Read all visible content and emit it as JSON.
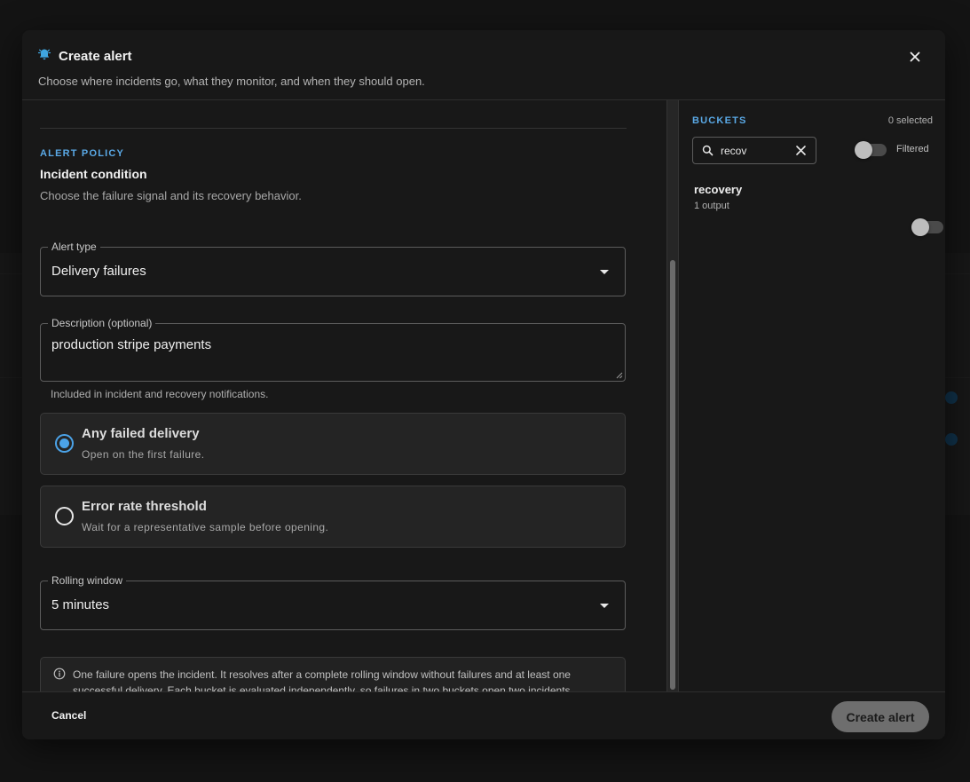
{
  "dialog": {
    "title": "Create alert",
    "subtitle": "Choose where incidents go, what they monitor, and when they should open."
  },
  "policy": {
    "eyebrow": "ALERT POLICY",
    "title": "Incident condition",
    "description": "Choose the failure signal and its recovery behavior.",
    "alert_type": {
      "label": "Alert type",
      "value": "Delivery failures"
    },
    "description_field": {
      "label": "Description (optional)",
      "value": "production stripe payments",
      "helper": "Included in incident and recovery notifications."
    },
    "options": [
      {
        "title": "Any failed delivery",
        "desc": "Open on the first failure.",
        "checked": true
      },
      {
        "title": "Error rate threshold",
        "desc": "Wait for a representative sample before opening.",
        "checked": false
      }
    ],
    "rolling_window": {
      "label": "Rolling window",
      "value": "5 minutes"
    },
    "info": "One failure opens the incident. It resolves after a complete rolling window without failures and at least one successful delivery. Each bucket is evaluated independently, so failures in two buckets open two incidents."
  },
  "buckets": {
    "label": "BUCKETS",
    "selected_count": "0 selected",
    "search_value": "recov",
    "filtered_label": "Filtered",
    "items": [
      {
        "name": "recovery",
        "sub": "1 output",
        "enabled": false
      }
    ]
  },
  "footer": {
    "cancel_label": "Cancel",
    "create_label": "Create alert"
  },
  "colors": {
    "accent": "#4ba3e8",
    "eyebrow": "#5aa9e6",
    "bell": "#3fa6e0"
  }
}
